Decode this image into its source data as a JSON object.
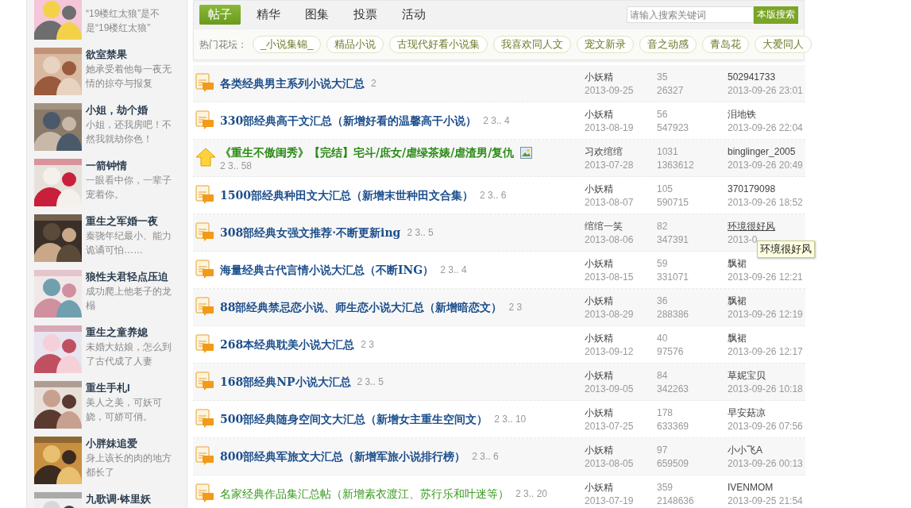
{
  "sidebar": {
    "items": [
      {
        "description": "“19楼红太狼”是不是“19楼红太狼”"
      },
      {
        "title": "欲室禁果",
        "description": "她承受着他每一夜无情的掠夺与报复"
      },
      {
        "title": "小姐，劫个婚",
        "description": "小姐，还我房吧！不然我就劫你色！"
      },
      {
        "title": "一箭钟情",
        "description": "一眼看中你，一辈子宠着你。"
      },
      {
        "title": "重生之军婚一夜",
        "description": "秦骁年纪最小、能力诡谲可怕……"
      },
      {
        "title": "狼性夫君轻点压迫",
        "description": "成功爬上他老子的龙榻"
      },
      {
        "title": "重生之童养媳",
        "description": "未婚大姑娘，怎么到了古代成了人妻"
      },
      {
        "title": "重生手札I",
        "description": "美人之美，可妖可娆，可娇可俏。"
      },
      {
        "title": "小胖妹追爱",
        "description": "身上该长的肉的地方都长了"
      },
      {
        "title": "九歌调·钵里妖"
      }
    ]
  },
  "tabs": [
    {
      "label": "帖子",
      "selected": true
    },
    {
      "label": "精华",
      "selected": false
    },
    {
      "label": "图集",
      "selected": false
    },
    {
      "label": "投票",
      "selected": false
    },
    {
      "label": "活动",
      "selected": false
    }
  ],
  "search": {
    "placeholder": "请输入搜索关键词",
    "button": "本版搜索"
  },
  "hot_forums": {
    "label": "热门花坛：",
    "tags": [
      "_小说集锦_",
      "精品小说",
      "古现代好看小说集",
      "我喜欢同人文",
      "宠文新录",
      "音之动感",
      "青岛花",
      "大爱同人"
    ]
  },
  "threads": [
    {
      "kind": "hot",
      "color": "#1d4f8c",
      "bold": true,
      "title": "各类经典男主系列小说大汇总",
      "has_image": false,
      "pages": "2",
      "author": "小妖精",
      "date": "2013-09-25",
      "replies": "35",
      "views": "26327",
      "last_poster": "502941733",
      "last_date": "2013-09-26 23:01",
      "hovered": false
    },
    {
      "kind": "hot",
      "color": "#1d4f8c",
      "bold": true,
      "title": "330部经典高干文汇总（新增好看的温馨高干小说）",
      "has_image": false,
      "pages": "2 3.. 4",
      "author": "小妖精",
      "date": "2013-08-19",
      "replies": "56",
      "views": "547923",
      "last_poster": "泪地铁",
      "last_date": "2013-09-26 22:04",
      "hovered": false
    },
    {
      "kind": "top",
      "color": "#2a8a16",
      "bold": true,
      "title": "《重生不傲闺秀》【完结】宅斗/庶女/虐绿茶婊/虐渣男/复仇",
      "has_image": true,
      "pages": "2 3.. 58",
      "author": "习欢绾绾",
      "date": "2013-07-28",
      "replies": "1031",
      "views": "1363612",
      "last_poster": "binglinger_2005",
      "last_date": "2013-09-26 20:49",
      "hovered": false
    },
    {
      "kind": "hot",
      "color": "#1d4f8c",
      "bold": true,
      "title": "1500部经典种田文大汇总（新增末世种田文合集）",
      "has_image": false,
      "pages": "2 3.. 6",
      "author": "小妖精",
      "date": "2013-08-07",
      "replies": "105",
      "views": "590715",
      "last_poster": "370179098",
      "last_date": "2013-09-26 18:52",
      "hovered": false
    },
    {
      "kind": "hot",
      "color": "#1d4f8c",
      "bold": true,
      "title": "308部经典女强文推荐·不断更新ing",
      "has_image": false,
      "pages": "2 3.. 5",
      "author": "绾绾一笑",
      "date": "2013-08-06",
      "replies": "82",
      "views": "347391",
      "last_poster": "环境很好风",
      "last_date": "2013-0",
      "hovered": true
    },
    {
      "kind": "hot",
      "color": "#1d4f8c",
      "bold": true,
      "title": "海量经典古代言情小说大汇总（不断ING）",
      "has_image": false,
      "pages": "2 3.. 4",
      "author": "小妖精",
      "date": "2013-08-15",
      "replies": "59",
      "views": "331071",
      "last_poster": "飘裙",
      "last_date": "2013-09-26 12:21",
      "hovered": false
    },
    {
      "kind": "hot",
      "color": "#1d4f8c",
      "bold": true,
      "title": "88部经典禁忌恋小说、师生恋小说大汇总（新增暗恋文）",
      "has_image": false,
      "pages": "2 3",
      "author": "小妖精",
      "date": "2013-08-29",
      "replies": "36",
      "views": "288386",
      "last_poster": "飘裙",
      "last_date": "2013-09-26 12:19",
      "hovered": false
    },
    {
      "kind": "hot",
      "color": "#1d4f8c",
      "bold": true,
      "title": "268本经典耽美小说大汇总",
      "has_image": false,
      "pages": "2 3",
      "author": "小妖精",
      "date": "2013-09-12",
      "replies": "40",
      "views": "97576",
      "last_poster": "飘裙",
      "last_date": "2013-09-26 12:17",
      "hovered": false
    },
    {
      "kind": "hot",
      "color": "#1d4f8c",
      "bold": true,
      "title": "168部经典NP小说大汇总",
      "has_image": false,
      "pages": "2 3.. 5",
      "author": "小妖精",
      "date": "2013-09-05",
      "replies": "84",
      "views": "342263",
      "last_poster": "草妮宝贝",
      "last_date": "2013-09-26 10:18",
      "hovered": false
    },
    {
      "kind": "hot",
      "color": "#1d4f8c",
      "bold": true,
      "title": "500部经典随身空间文大汇总（新增女主重生空间文）",
      "has_image": false,
      "pages": "2 3.. 10",
      "author": "小妖精",
      "date": "2013-07-25",
      "replies": "178",
      "views": "633369",
      "last_poster": "早安菇凉",
      "last_date": "2013-09-26 07:56",
      "hovered": false
    },
    {
      "kind": "hot",
      "color": "#1d4f8c",
      "bold": true,
      "title": "800部经典军旅文大汇总（新增军旅小说排行榜）",
      "has_image": false,
      "pages": "2 3.. 6",
      "author": "小妖精",
      "date": "2013-08-05",
      "replies": "97",
      "views": "659509",
      "last_poster": "小小飞A",
      "last_date": "2013-09-26 00:13",
      "hovered": false
    },
    {
      "kind": "hot",
      "color": "#3a9a20",
      "bold": false,
      "title": "名家经典作品集汇总帖（新增素衣渡江、苏行乐和叶迷等）",
      "has_image": false,
      "pages": "2 3.. 20",
      "author": "小妖精",
      "date": "2013-07-19",
      "replies": "359",
      "views": "2148636",
      "last_poster": "IVENMOM",
      "last_date": "2013-09-25 21:54",
      "hovered": false
    }
  ],
  "tooltip": {
    "text": "环境很好风"
  }
}
